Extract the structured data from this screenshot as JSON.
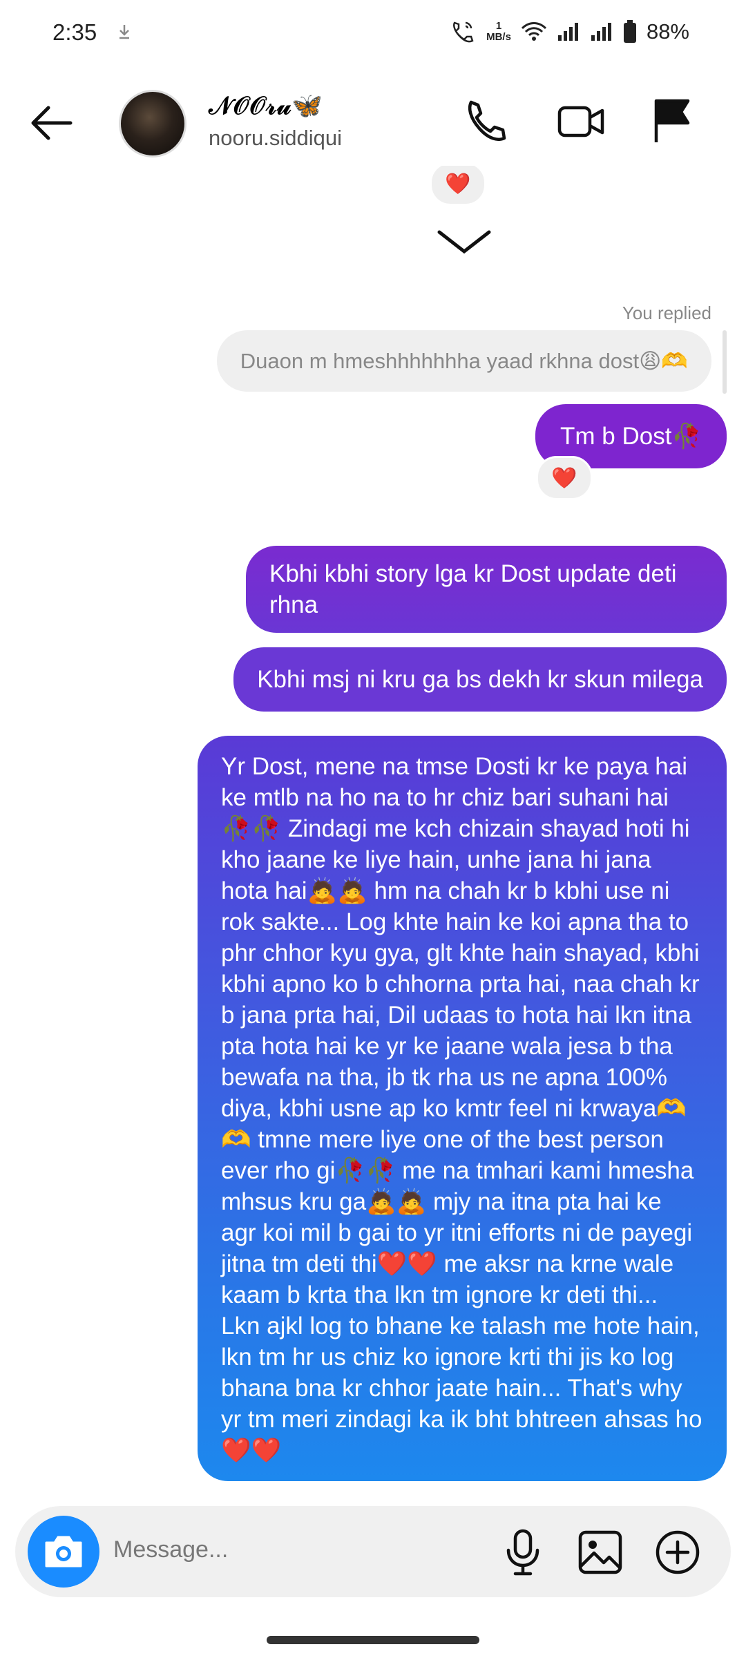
{
  "status_bar": {
    "time": "2:35",
    "net_speed_value": "1",
    "net_speed_unit": "MB/s",
    "battery": "88%",
    "icons": [
      "download-icon",
      "wifi-call-icon",
      "wifi-icon",
      "signal-icon",
      "signal-icon",
      "battery-icon"
    ]
  },
  "header": {
    "display_name": "𝒩𝒪𝒪𝓇𝓊🦋",
    "username": "nooru.siddiqui",
    "icons": [
      "back-arrow-icon",
      "phone-icon",
      "video-icon",
      "flag-icon"
    ]
  },
  "messages": {
    "reaction_heart": "❤️",
    "you_replied": "You replied",
    "replied_to": "Duaon m hmeshhhhhhha yaad rkhna dost😩🫶",
    "m1": "Tm b Dost🥀",
    "m2": "Kbhi kbhi story lga kr Dost update deti rhna",
    "m3": "Kbhi msj ni kru ga bs dekh kr skun milega",
    "m4": "Yr Dost, mene na tmse Dosti kr ke paya hai ke mtlb na ho na to hr chiz bari suhani hai 🥀🥀 Zindagi me kch chizain shayad hoti hi kho jaane ke liye hain, unhe jana hi jana hota hai🙇🙇 hm na chah kr b kbhi use ni rok sakte... Log khte hain ke koi apna tha to phr chhor kyu gya, glt khte hain shayad, kbhi kbhi apno ko b chhorna prta hai, naa chah kr b jana prta hai, Dil udaas to hota hai lkn itna pta hota hai ke yr ke jaane wala jesa b tha bewafa na tha, jb tk rha us ne apna 100% diya, kbhi usne ap ko kmtr feel ni krwaya🫶🫶 tmne mere liye one of the best person ever rho gi🥀🥀 me na tmhari kami hmesha mhsus kru ga🙇🙇 mjy na itna pta hai ke agr koi mil b gai to yr itni efforts ni de payegi jitna tm deti thi❤️❤️ me aksr na krne wale kaam b krta tha lkn tm ignore kr deti thi... Lkn ajkl log to bhane ke talash me hote hain, lkn tm hr us chiz ko ignore krti thi jis ko log bhana bna kr chhor jaate hain... That's why yr tm meri zindagi ka ik bht bhtreen ahsas ho❤️❤️"
  },
  "composer": {
    "placeholder": "Message...",
    "icons": [
      "camera-icon",
      "microphone-icon",
      "gallery-icon",
      "add-icon"
    ]
  },
  "colors": {
    "sent_purple": "#7e25cf",
    "sent_blue": "#1d88ee",
    "camera_blue": "#1a8cff",
    "reaction_red": "#e0202e"
  }
}
